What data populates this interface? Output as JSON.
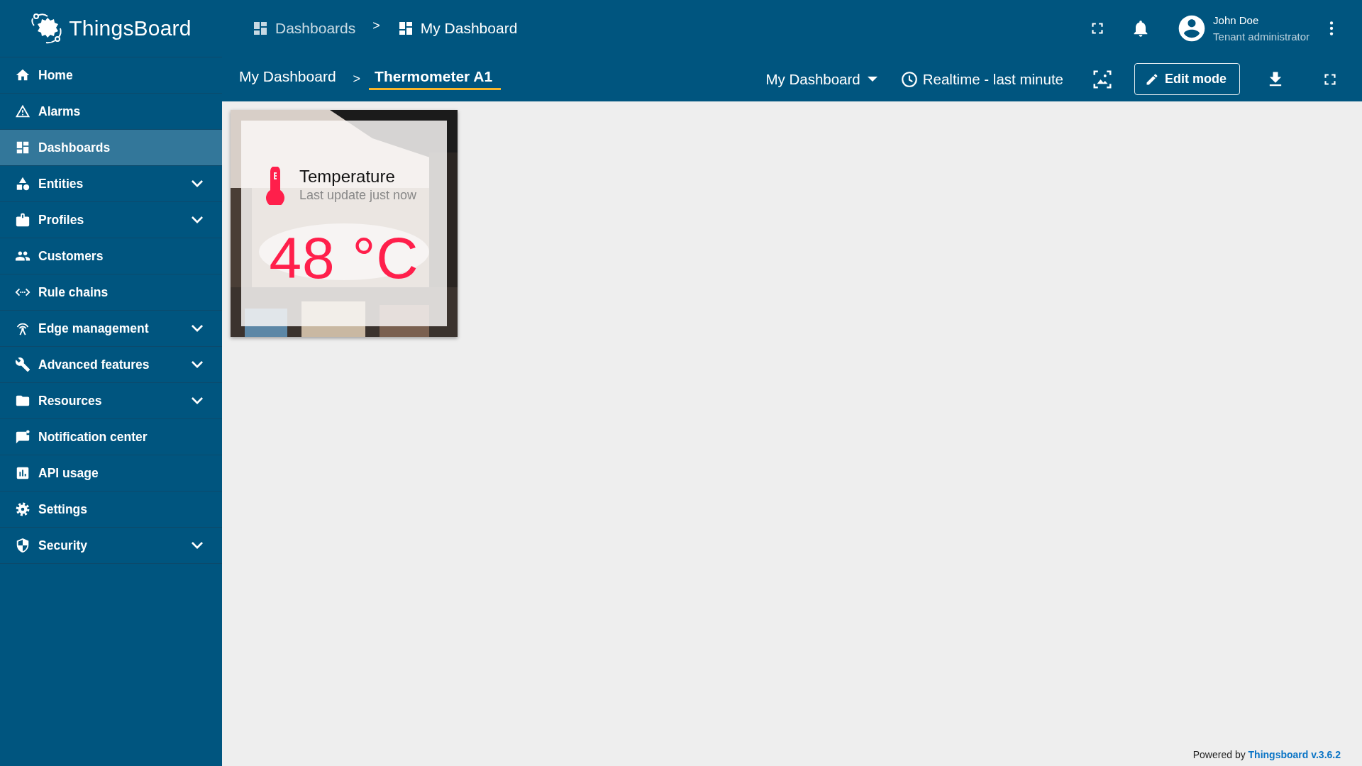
{
  "logo": {
    "text": "ThingsBoard"
  },
  "sidebar": {
    "items": [
      {
        "label": "Home",
        "selected": false,
        "expandable": false
      },
      {
        "label": "Alarms",
        "selected": false,
        "expandable": false
      },
      {
        "label": "Dashboards",
        "selected": true,
        "expandable": false
      },
      {
        "label": "Entities",
        "selected": false,
        "expandable": true
      },
      {
        "label": "Profiles",
        "selected": false,
        "expandable": true
      },
      {
        "label": "Customers",
        "selected": false,
        "expandable": false
      },
      {
        "label": "Rule chains",
        "selected": false,
        "expandable": false
      },
      {
        "label": "Edge management",
        "selected": false,
        "expandable": true
      },
      {
        "label": "Advanced features",
        "selected": false,
        "expandable": true
      },
      {
        "label": "Resources",
        "selected": false,
        "expandable": true
      },
      {
        "label": "Notification center",
        "selected": false,
        "expandable": false
      },
      {
        "label": "API usage",
        "selected": false,
        "expandable": false
      },
      {
        "label": "Settings",
        "selected": false,
        "expandable": false
      },
      {
        "label": "Security",
        "selected": false,
        "expandable": true
      }
    ]
  },
  "header": {
    "breadcrumb": [
      {
        "label": "Dashboards",
        "selected": false
      },
      {
        "label": "My Dashboard",
        "selected": true
      }
    ],
    "separator": ">",
    "user": {
      "name": "John Doe",
      "role": "Tenant administrator"
    }
  },
  "toolbar": {
    "states": [
      {
        "label": "My Dashboard",
        "selected": false
      },
      {
        "label": "Thermometer A1",
        "selected": true
      }
    ],
    "separator": ">",
    "dashboard_select": "My Dashboard",
    "timewindow": "Realtime - last minute",
    "edit_button": "Edit mode"
  },
  "widget": {
    "title": "Temperature",
    "subtitle": "Last update just now",
    "value": "48 °C"
  },
  "footer": {
    "prefix": "Powered by",
    "link": "Thingsboard v.3.6.2"
  }
}
